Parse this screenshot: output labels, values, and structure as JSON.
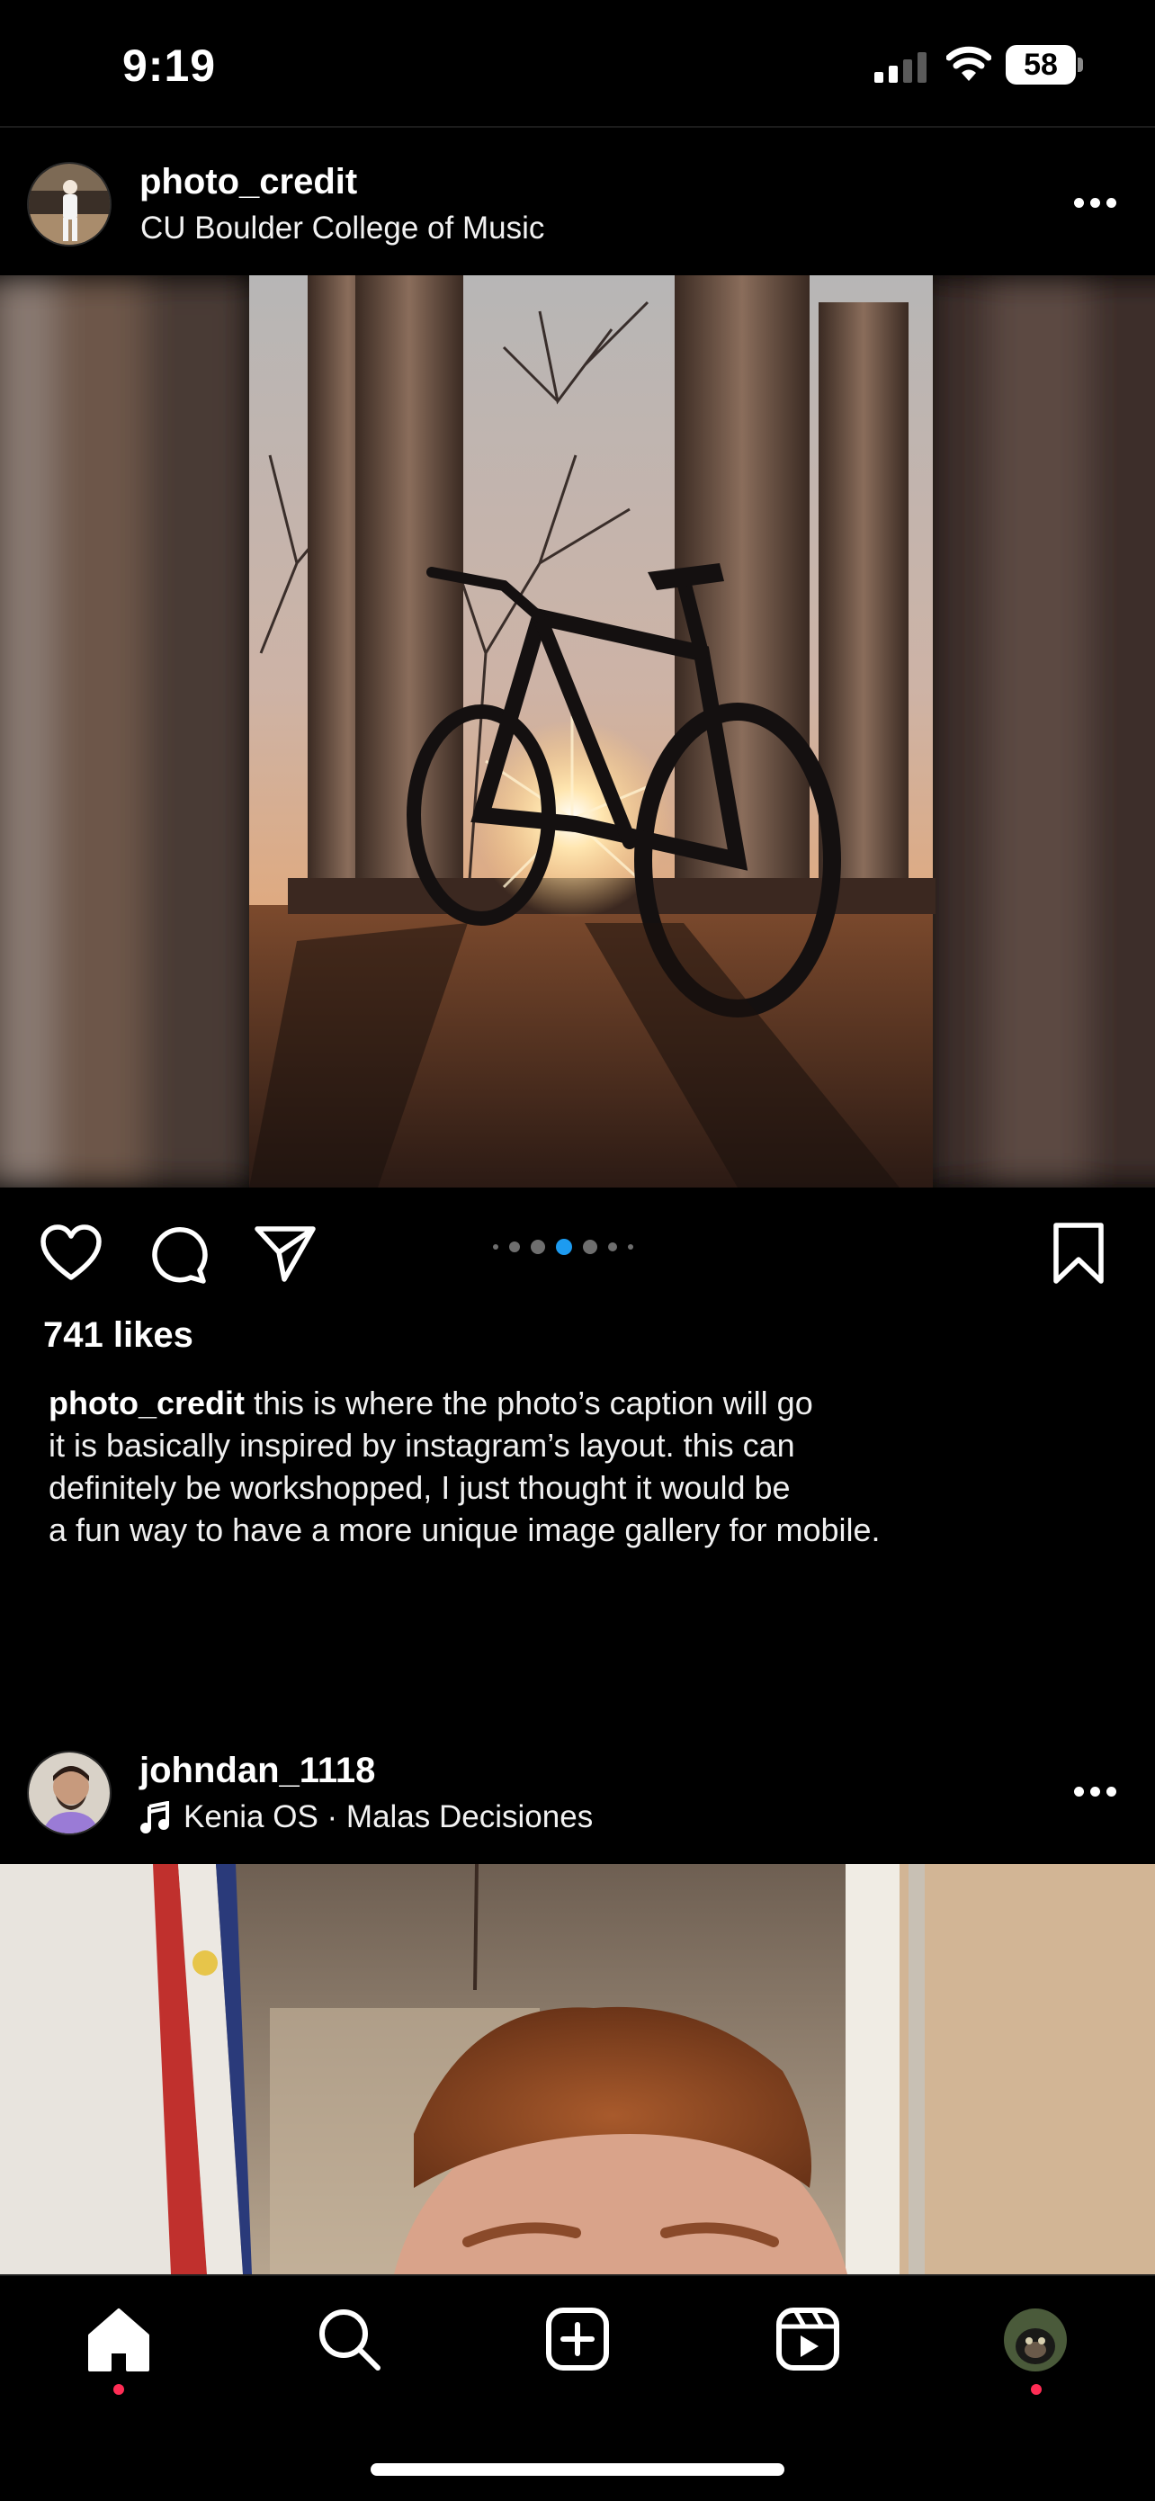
{
  "status_bar": {
    "time": "9:19",
    "battery": "58"
  },
  "posts": [
    {
      "username": "photo_credit",
      "subtitle": "CU Boulder College of Music",
      "likes": "741 likes",
      "caption_user": "photo_credit",
      "caption_lines": [
        "this is where the photo’s caption will go",
        "it is basically inspired by instagram’s layout. this can",
        "definitely be workshopped, I just thought it would be",
        "a fun way to have a more unique image gallery for mobile."
      ],
      "carousel": {
        "count": 6,
        "active_index": 2
      }
    },
    {
      "username": "johndan_1118",
      "audio": "Kenia OS · Malas Decisiones"
    }
  ],
  "tabbar": {
    "items": [
      {
        "name": "home",
        "active": true
      },
      {
        "name": "search"
      },
      {
        "name": "create"
      },
      {
        "name": "reels"
      },
      {
        "name": "profile",
        "badge": true
      }
    ]
  },
  "colors": {
    "accent_blue": "#1d9bf0",
    "notification_red": "#ff2d55",
    "background": "#000000"
  }
}
